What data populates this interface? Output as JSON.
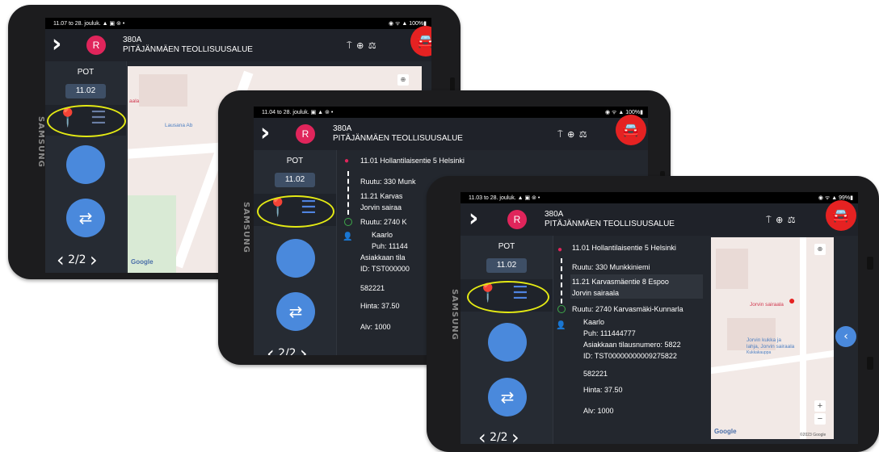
{
  "devices": [
    {
      "status_left": "11.07 to 28. jouluk. ▲ ▣ ⊚ •",
      "status_right": "◉ ᯤ ▲ 100%▮",
      "brand": "SAMSUNG",
      "header": {
        "route": "380A",
        "area": "PITÄJÄNMÄEN TEOLLISUUSALUE"
      },
      "sidebar": {
        "pot_label": "POT",
        "pot_time": "11.02",
        "pager": "2/2"
      },
      "map": {
        "labels": [
          "aala",
          "Lausana Ab"
        ],
        "google": "Google"
      }
    },
    {
      "status_left": "11.04 to 28. jouluk. ▣ ▲ ⊚ •",
      "status_right": "◉ ᯤ ▲ 100%▮",
      "brand": "SAMSUNG",
      "header": {
        "route": "380A",
        "area": "PITÄJÄNMÄEN TEOLLISUUSALUE"
      },
      "sidebar": {
        "pot_label": "POT",
        "pot_time": "11.02",
        "pager": "2/2"
      },
      "trip": {
        "pickup": "11.01 Hollantilaisentie 5 Helsinki",
        "pickup_ruutu": "Ruutu: 330 Munk",
        "dropoff_line1": "11.21 Karvas",
        "dropoff_line2": "Jorvin sairaa",
        "dropoff_ruutu": "Ruutu: 2740 K",
        "name": "Kaarlo",
        "phone": "Puh: 11144",
        "order": "Asiakkaan tila",
        "id": "ID: TST000000",
        "code": "582221",
        "price": "Hinta: 37.50",
        "vat": "Alv: 1000"
      }
    },
    {
      "status_left": "11.03 to 28. jouluk. ▲ ▣ ⊚ •",
      "status_right": "◉ ᯤ ▲ 99%▮",
      "brand": "SAMSUNG",
      "header": {
        "route": "380A",
        "area": "PITÄJÄNMÄEN TEOLLISUUSALUE"
      },
      "sidebar": {
        "pot_label": "POT",
        "pot_time": "11.02",
        "pager": "2/2"
      },
      "trip": {
        "pickup": "11.01 Hollantilaisentie 5 Helsinki",
        "pickup_ruutu": "Ruutu: 330 Munkkiniemi",
        "dropoff_line1": "11.21 Karvasmäentie 8 Espoo",
        "dropoff_line2": "Jorvin sairaala",
        "dropoff_ruutu": "Ruutu: 2740 Karvasmäki-Kunnarla",
        "name": "Kaarlo",
        "phone": "Puh: 111444777",
        "order": "Asiakkaan tilausnumero: 5822",
        "id": "ID: TST00000000009275822",
        "code": "582221",
        "price": "Hinta: 37.50",
        "vat": "Alv: 1000"
      },
      "map": {
        "destination_label": "Jorvin sairaala",
        "poi_label1": "Jorvin kukka ja",
        "poi_label2": "lahja, Jorvin sairaala",
        "poi_label3": "Kukkakauppa",
        "google": "Google",
        "copyright": "©2023 Google",
        "zoom_in": "+",
        "zoom_out": "−"
      }
    }
  ],
  "icons": {
    "chevron_right": "›",
    "chevron_left": "‹",
    "header_icons": "⍑ ⊕ ⚖",
    "car": "🚘",
    "map_pin": "📍",
    "list": "☰",
    "person": "👤",
    "transfer": "⇄"
  },
  "colors": {
    "accent_blue": "#4a89dc",
    "red": "#e52222",
    "avatar_pink": "#e0255b",
    "highlight_yellow": "#e4ea14"
  }
}
